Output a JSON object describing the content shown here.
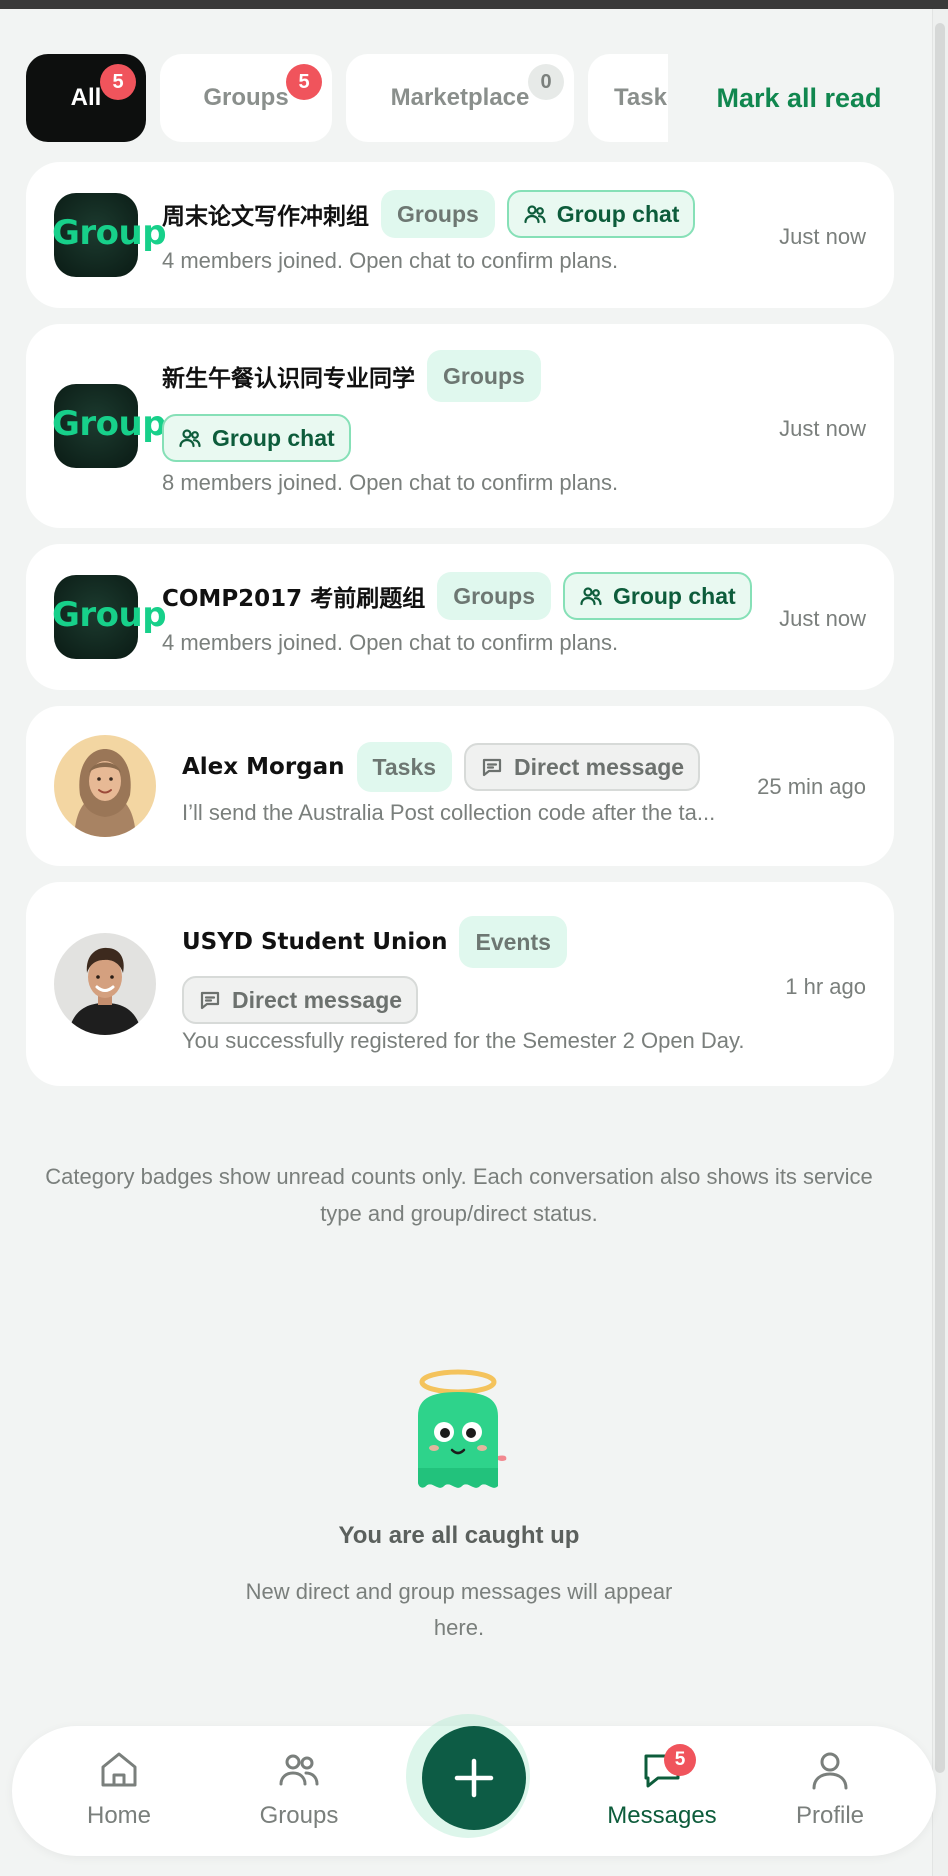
{
  "tabs": [
    {
      "label": "All",
      "badge": "5",
      "active": true
    },
    {
      "label": "Groups",
      "badge": "5"
    },
    {
      "label": "Marketplace",
      "badge": "0"
    },
    {
      "label": "Tasks"
    }
  ],
  "mark_all_read": "Mark all read",
  "conversations": [
    {
      "avatar_text": "Group",
      "name": "周末论文写作冲刺组",
      "service": "Groups",
      "chat_type": "Group chat",
      "preview": "4 members joined. Open chat to confirm plans.",
      "time": "Just now"
    },
    {
      "avatar_text": "Group",
      "name": "新生午餐认识同专业同学",
      "service": "Groups",
      "chat_type": "Group chat",
      "preview": "8 members joined. Open chat to confirm plans.",
      "time": "Just now"
    },
    {
      "avatar_text": "Group",
      "name": "COMP2017 考前刷题组",
      "service": "Groups",
      "chat_type": "Group chat",
      "preview": "4 members joined. Open chat to confirm plans.",
      "time": "Just now"
    },
    {
      "name": "Alex Morgan",
      "service": "Tasks",
      "chat_type": "Direct message",
      "preview": "I’ll send the Australia Post collection code after the ta...",
      "time": "25 min ago"
    },
    {
      "name": "USYD Student Union",
      "service": "Events",
      "chat_type": "Direct message",
      "preview": "You successfully registered for the Semester 2 Open Day.",
      "time": "1 hr ago"
    }
  ],
  "footer_note": "Category badges show unread counts only. Each conversation also shows its service type and group/direct status.",
  "empty_state": {
    "title": "You are all caught up",
    "subtitle": "New direct and group messages will appear here."
  },
  "bottom_nav": {
    "items": [
      {
        "label": "Home",
        "icon": "home-icon"
      },
      {
        "label": "Groups",
        "icon": "groups-icon"
      },
      {
        "label": "Messages",
        "icon": "messages-icon",
        "badge": "5",
        "active": true
      },
      {
        "label": "Profile",
        "icon": "profile-icon"
      }
    ],
    "fab_icon": "plus-icon"
  },
  "colors": {
    "accent": "#11874f",
    "dark_green": "#0d5c45",
    "badge_red": "#f0545c",
    "service_pill_bg": "#e0f8ee"
  }
}
